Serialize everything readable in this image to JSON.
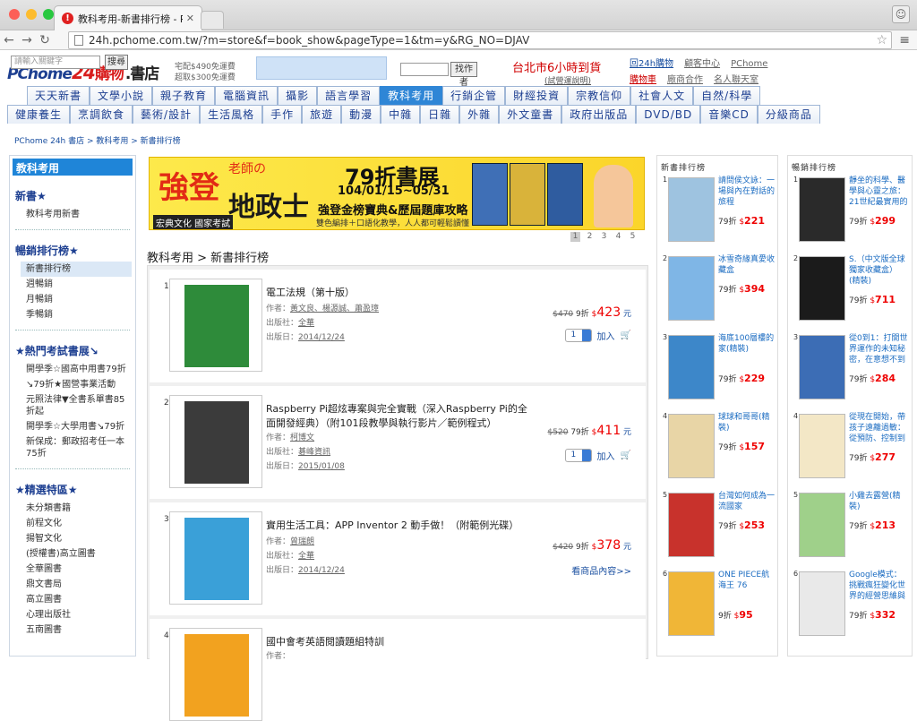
{
  "browser": {
    "tab_title": "教科考用-新書排行榜 - PCho",
    "url": "24h.pchome.com.tw/?m=store&f=book_show&pageType=1&tm=y&RG_NO=DJAV"
  },
  "header": {
    "logo_brand": "PChome",
    "logo_num": "24",
    "logo_text": "購物",
    "logo_store": ".書店",
    "ship_line1": "宅配$490免運費",
    "ship_line2": "超取$300免運費",
    "search_placeholder": "請輸入關鍵字",
    "search_button": "搜尋",
    "search_button2": "找作者",
    "promo": "台北市6小時到貨",
    "promo_sub": "(試營運說明)",
    "links_row1": [
      "回24h購物",
      "顧客中心",
      "PChome"
    ],
    "links_row2": [
      "購物車",
      "廠商合作",
      "名人聯天室"
    ]
  },
  "categories": {
    "row1": [
      "天天新書",
      "文學小說",
      "親子教育",
      "電腦資訊",
      "攝影",
      "語言學習",
      "教科考用",
      "行銷企管",
      "財經投資",
      "宗教信仰",
      "社會人文",
      "自然/科學"
    ],
    "row2": [
      "健康養生",
      "烹調飲食",
      "藝術/設計",
      "生活風格",
      "手作",
      "旅遊",
      "動漫",
      "中雜",
      "日雜",
      "外雜",
      "外文童書",
      "政府出版品",
      "DVD/BD",
      "音樂CD",
      "分級商品"
    ],
    "active": "教科考用"
  },
  "breadcrumb": "PChome 24h 書店 > 教科考用 > 新書排行榜",
  "sidebar": {
    "heading": "教科考用",
    "sections": [
      {
        "title": "新書★",
        "items": [
          "教科考用新書"
        ]
      },
      {
        "title": "暢銷排行榜★",
        "items": [
          "新書排行榜",
          "週暢銷",
          "月暢銷",
          "季暢銷"
        ]
      },
      {
        "title": "★熱門考試書展↘",
        "items": [
          "開學季☆國高中用書79折",
          "↘79折★國營事業活動",
          "元照法律▼全書系單書85折起",
          "開學季☆大學用書↘79折",
          "新保成：郵政招考任一本75折"
        ]
      },
      {
        "title": "★精選特區★",
        "items": [
          "未分類書籍",
          "前程文化",
          "揚智文化",
          "(授權書)高立圖書",
          "全華圖書",
          "鼎文書局",
          "高立圖書",
          "心理出版社",
          "五南圖書"
        ]
      }
    ]
  },
  "banner": {
    "word1": "強登",
    "word2": "老師の",
    "word3": "地政士",
    "headline": "79折書展",
    "dates": "104/01/15~05/31",
    "sub": "強登金榜寶典&歷屆題庫攻略",
    "desc": "雙色編排＋口語化教學，人人都可輕鬆讀懂",
    "badge": "宏典文化 國家考試"
  },
  "pager": [
    "1",
    "2",
    "3",
    "4",
    "5"
  ],
  "content_title": "教科考用 > 新書排行榜",
  "products": [
    {
      "rank": "1",
      "title": "電工法規（第十版）",
      "author_label": "作者：",
      "author": "黃文良、楊源誠、蕭盈璋",
      "pub_label": "出版社：",
      "publisher": "全華",
      "date_label": "出版日：",
      "date": "2014/12/24",
      "orig": "$470",
      "disc": "9折",
      "price": "423",
      "unit": "元",
      "qty": "1",
      "cart": "加入",
      "cover": "#2e8b3a"
    },
    {
      "rank": "2",
      "title": "Raspberry Pi超炫專案與完全實戰（深入Raspberry Pi的全面開發經典）（附101段教學與執行影片／範例程式）",
      "author_label": "作者：",
      "author": "柯博文",
      "pub_label": "出版社：",
      "publisher": "碁峰資訊",
      "date_label": "出版日：",
      "date": "2015/01/08",
      "orig": "$520",
      "disc": "79折",
      "price": "411",
      "unit": "元",
      "qty": "1",
      "cart": "加入",
      "cover": "#3b3b3b"
    },
    {
      "rank": "3",
      "title": "實用生活工具：APP Inventor 2 動手做！（附範例光碟）",
      "author_label": "作者：",
      "author": "曾瑞朗",
      "pub_label": "出版社：",
      "publisher": "全華",
      "date_label": "出版日：",
      "date": "2014/12/24",
      "orig": "$420",
      "disc": "9折",
      "price": "378",
      "unit": "元",
      "more": "看商品內容>>",
      "cover": "#3aa0d8"
    },
    {
      "rank": "4",
      "title": "國中會考英語閱讀題組特訓",
      "author_label": "作者：",
      "author": "",
      "cover": "#f2a21f"
    }
  ],
  "new_rank": {
    "heading": "新書排行榜",
    "items": [
      {
        "n": "1",
        "title": "請問侯文詠：一場與內在對話的旅程",
        "disc": "79折",
        "price": "221",
        "cover": "#9ec3e0"
      },
      {
        "n": "2",
        "title": "冰雪奇緣真愛收藏盒",
        "disc": "79折",
        "price": "394",
        "cover": "#7fb6e6"
      },
      {
        "n": "3",
        "title": "海底100層樓的家(精裝)",
        "disc": "79折",
        "price": "229",
        "cover": "#3d87c9"
      },
      {
        "n": "4",
        "title": "球球和哥哥(精裝)",
        "disc": "79折",
        "price": "157",
        "cover": "#e8d5a6"
      },
      {
        "n": "5",
        "title": "台灣如何成為一流國家",
        "disc": "79折",
        "price": "253",
        "cover": "#c8322c"
      },
      {
        "n": "6",
        "title": "ONE PIECE航海王 76",
        "disc": "9折",
        "price": "95",
        "cover": "#f0b637"
      }
    ]
  },
  "best_rank": {
    "heading": "暢銷排行榜",
    "items": [
      {
        "n": "1",
        "title": "靜坐的科學、醫學與心靈之旅：21世紀最實用的",
        "disc": "79折",
        "price": "299",
        "cover": "#2a2a2a"
      },
      {
        "n": "2",
        "title": "S.（中文版全球獨家收藏盒）(精裝)",
        "disc": "79折",
        "price": "711",
        "cover": "#1b1b1b"
      },
      {
        "n": "3",
        "title": "從0到1：打開世界運作的未知秘密，在意想不到",
        "disc": "79折",
        "price": "284",
        "cover": "#3c6db5"
      },
      {
        "n": "4",
        "title": "從現在開始，帶孩子遠離過敏：從預防、控制到",
        "disc": "79折",
        "price": "277",
        "cover": "#f3e7c6"
      },
      {
        "n": "5",
        "title": "小雞去露營(精裝)",
        "disc": "79折",
        "price": "213",
        "cover": "#9fd08a"
      },
      {
        "n": "6",
        "title": "Google模式：挑戰瘋狂變化世界的經營思維與",
        "disc": "79折",
        "price": "332",
        "cover": "#e9e9e9"
      }
    ]
  }
}
